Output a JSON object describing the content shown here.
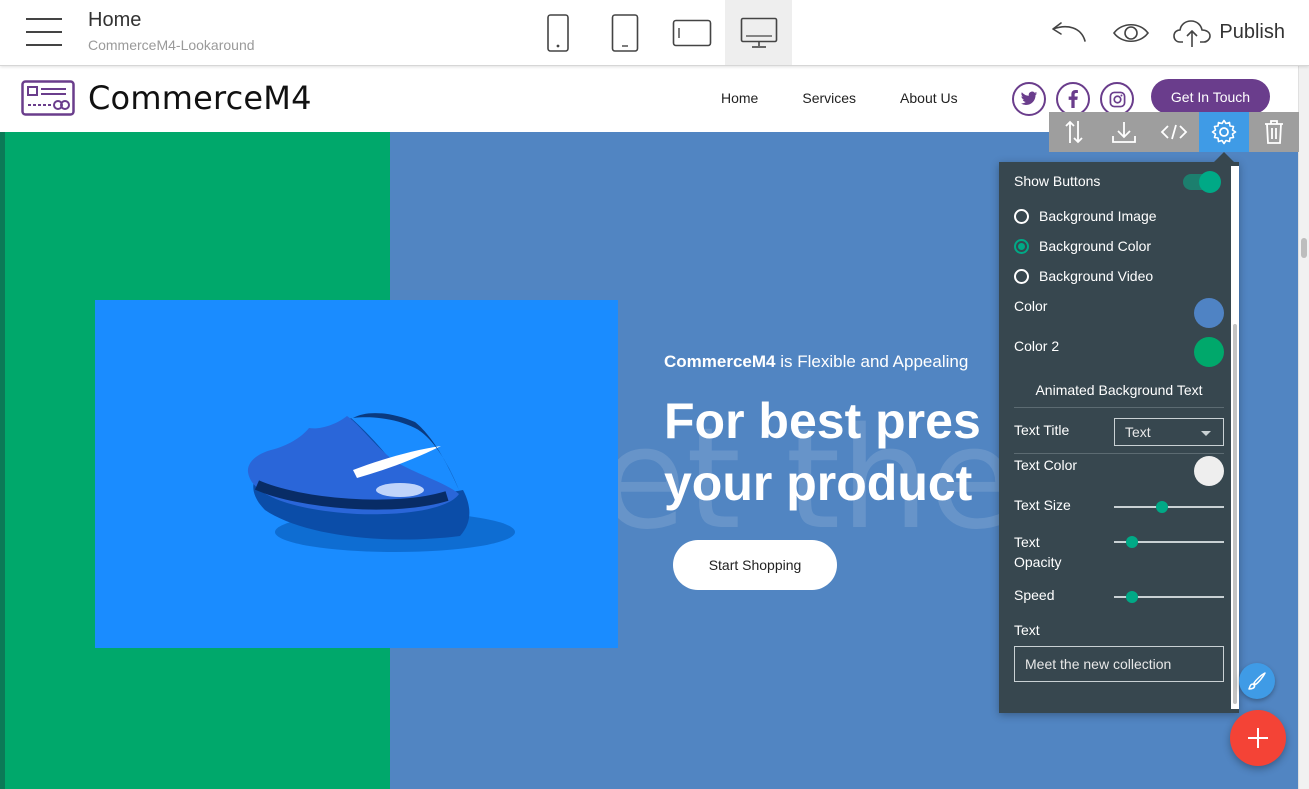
{
  "editor": {
    "page_title": "Home",
    "project_name": "CommerceM4-Lookaround",
    "devices": [
      "mobile-icon",
      "tablet-icon",
      "tablet-landscape-icon",
      "desktop-icon"
    ],
    "active_device": "desktop-icon",
    "publish_label": "Publish"
  },
  "site": {
    "brand": "CommerceM4",
    "nav": [
      "Home",
      "Services",
      "About Us"
    ],
    "socials": [
      "twitter-icon",
      "facebook-icon",
      "instagram-icon"
    ],
    "cta_label": "Get In Touch",
    "accent_color": "#6a3d8c"
  },
  "hero": {
    "eyebrow_bold": "CommerceM4",
    "eyebrow_rest": " is Flexible and Appealing",
    "title_line1": "For best pres",
    "title_line2": "your product",
    "button_label": "Start Shopping",
    "background_text": "et the  w",
    "bg_color": "#5185c2",
    "bg_color_2": "#00a86b"
  },
  "block_toolbar": {
    "buttons": [
      "reorder-icon",
      "download-icon",
      "code-icon",
      "gear-icon",
      "trash-icon"
    ],
    "active": "gear-icon"
  },
  "settings": {
    "show_buttons_label": "Show Buttons",
    "show_buttons_on": true,
    "background_options": [
      "Background Image",
      "Background Color",
      "Background Video"
    ],
    "background_selected": "Background Color",
    "color_label": "Color",
    "color_value": "#4f83c4",
    "color2_label": "Color 2",
    "color2_value": "#00a86b",
    "section_title": "Animated Background Text",
    "text_title_label": "Text Title",
    "text_title_value": "Text",
    "text_color_label": "Text Color",
    "text_color_value": "#eeeeee",
    "text_size_label": "Text Size",
    "text_size_value": 0.44,
    "text_opacity_label_1": "Text",
    "text_opacity_label_2": "Opacity",
    "text_opacity_value": 0.16,
    "speed_label": "Speed",
    "speed_value": 0.16,
    "text_label": "Text",
    "text_value": "Meet the new collection"
  }
}
